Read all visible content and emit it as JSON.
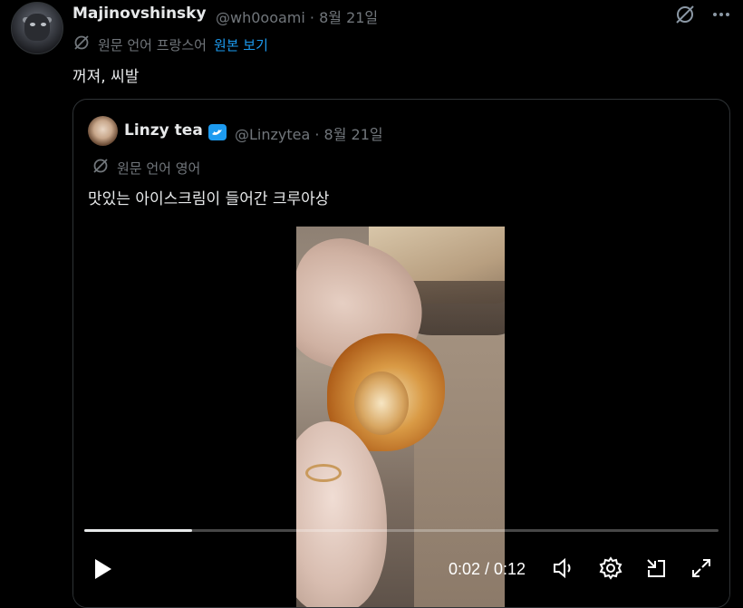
{
  "tweet": {
    "author_name": "Majinovshinsky",
    "author_meta": "@wh0ooami · 8월 21일",
    "translate_label": "원문 언어 프랑스어",
    "translate_link": "원본 보기",
    "text": "꺼져, 씨발"
  },
  "quoted": {
    "author_name": "Linzy tea",
    "author_meta": "@Linzytea · 8월 21일",
    "translate_label": "원문 언어 영어",
    "text": "맛있는 아이스크림이 들어간 크루아상",
    "video": {
      "time_display": "0:02 / 0:12",
      "progress": 0.17
    }
  },
  "colors": {
    "background": "#000000",
    "text": "#e7e9ea",
    "muted": "#71767b",
    "accent": "#1d9bf0",
    "border": "#2f3336"
  },
  "icons": [
    "grok-icon",
    "more-icon",
    "translate-icon",
    "verified-badge-icon",
    "play-icon",
    "volume-icon",
    "settings-icon",
    "dock-icon",
    "fullscreen-icon"
  ]
}
